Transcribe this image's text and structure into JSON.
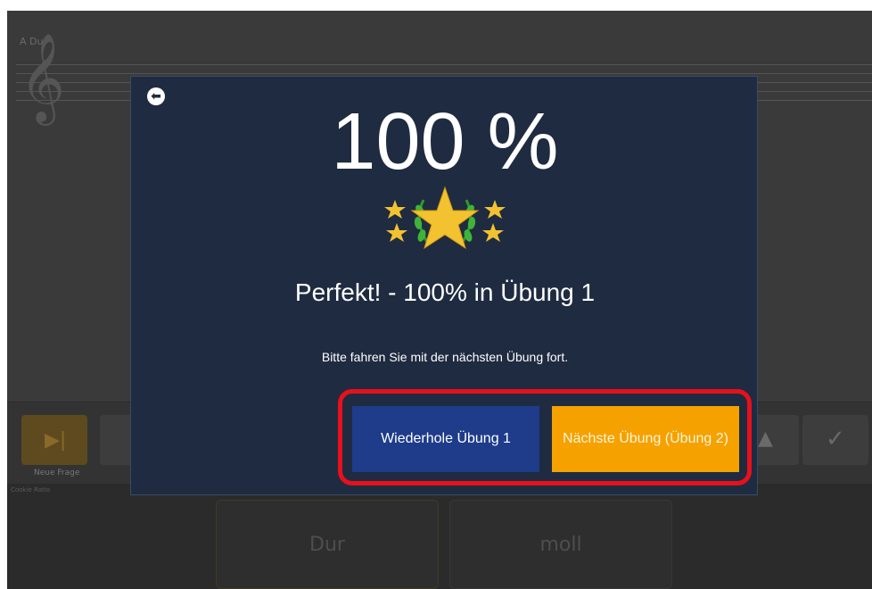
{
  "background": {
    "key_label": "A Dur",
    "clef": "𝄞",
    "toolbar": {
      "play_icon": "▶|",
      "play_label": "Neue Frage",
      "person_icon": "person-icon",
      "check_icon": "✓",
      "small_caption": "Cookie Ratio"
    },
    "answers": [
      "Dur",
      "moll"
    ]
  },
  "modal": {
    "back_icon": "⬅",
    "score": "100 %",
    "result_title": "Perfekt! - 100% in Übung 1",
    "instruction": "Bitte fahren Sie mit der nächsten Übung fort.",
    "buttons": {
      "repeat": "Wiederhole Übung 1",
      "next": "Nächste Übung (Übung 2)"
    }
  },
  "colors": {
    "modal_bg": "#1f2b40",
    "repeat_bg": "#1e3c8a",
    "next_bg": "#f5a100",
    "highlight": "#e8101a",
    "star": "#f2c230",
    "laurel": "#2e9a2a"
  }
}
